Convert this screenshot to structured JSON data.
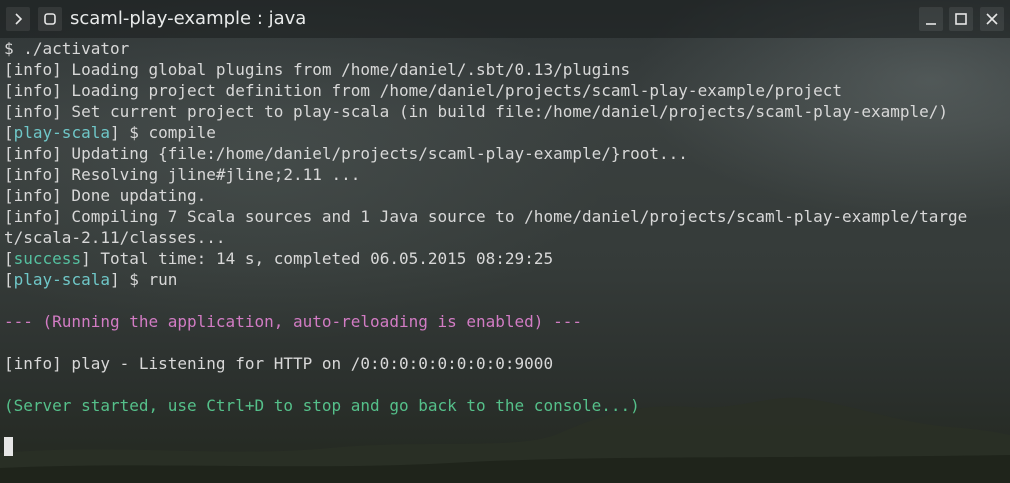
{
  "window": {
    "title": "scaml-play-example : java",
    "menu_icon": "chevron-right-icon",
    "app_icon": "square-icon",
    "controls": [
      "minimize-icon",
      "maximize-icon",
      "close-icon"
    ]
  },
  "colors": {
    "text": "#d8d8d8",
    "prompt_tag": "#6fc7c8",
    "success_tag": "#55c0a0",
    "magenta": "#d27cc4",
    "green": "#55c08a"
  },
  "terminal": {
    "l1": "$ ./activator",
    "l2": "[info] Loading global plugins from /home/daniel/.sbt/0.13/plugins",
    "l3": "[info] Loading project definition from /home/daniel/projects/scaml-play-example/project",
    "l4": "[info] Set current project to play-scala (in build file:/home/daniel/projects/scaml-play-example/)",
    "l5": {
      "open": "[",
      "tag": "play-scala",
      "close": "] $ compile"
    },
    "l6": "[info] Updating {file:/home/daniel/projects/scaml-play-example/}root...",
    "l7": "[info] Resolving jline#jline;2.11 ...",
    "l8": "[info] Done updating.",
    "l9": "[info] Compiling 7 Scala sources and 1 Java source to /home/daniel/projects/scaml-play-example/targe",
    "l10": "t/scala-2.11/classes...",
    "l11": {
      "open": "[",
      "tag": "success",
      "close": "] Total time: 14 s, completed 06.05.2015 08:29:25"
    },
    "l12": {
      "open": "[",
      "tag": "play-scala",
      "close": "] $ run"
    },
    "l13": "",
    "l14": "--- (Running the application, auto-reloading is enabled) ---",
    "l15": "",
    "l16": "[info] play - Listening for HTTP on /0:0:0:0:0:0:0:0:9000",
    "l17": "",
    "l18": "(Server started, use Ctrl+D to stop and go back to the console...)"
  }
}
